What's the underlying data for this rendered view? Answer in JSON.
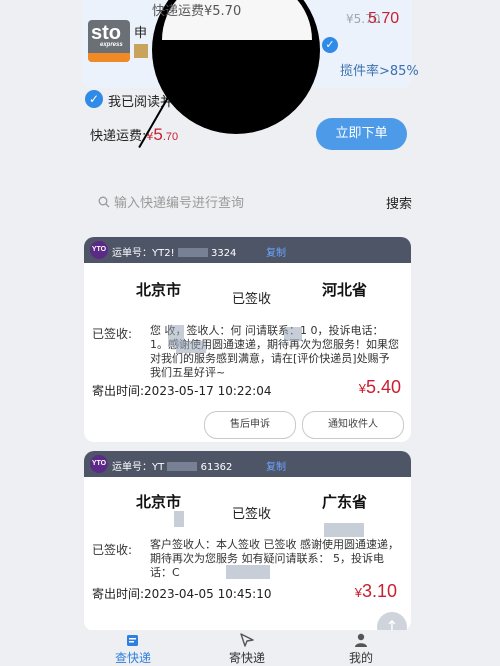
{
  "top_order": {
    "company_logo": "STO Express",
    "logo_main": "sto",
    "logo_sub": "express",
    "name_initial": "申",
    "faded_text": "¥5.70",
    "price": "5.70",
    "check_mark": "✓",
    "stir_rate": "揽件率>85%",
    "magnified_text": "快递运费¥5.70",
    "agree_text": "我已阅读并同",
    "fee_label": "快递运费:",
    "fee_yen": "¥",
    "fee_int": "5",
    "fee_dec": ".70",
    "order_button": "立即下单"
  },
  "search": {
    "placeholder": "输入快递编号进行查询",
    "button": "搜索"
  },
  "shipments": [
    {
      "logo": "YTO",
      "waybill_label": "运单号：YT2!",
      "waybill_tail": "3324",
      "copy": "复制",
      "from_city": "北京市",
      "status": "已签收",
      "to_city": "河北省",
      "detail_label": "已签收:",
      "detail_text": "您    收，签收人：何      问请联系：1        0，投诉电话：     1。感谢使用圆通速递，期待再次为您服务！如果您对我们的服务感到满意，请在[评价快递员]处赐予我们五星好评~",
      "time": "寄出时间:2023-05-17 10:22:04",
      "price_yen": "¥",
      "price": "5.40",
      "buttons": [
        "售后申诉",
        "通知收件人"
      ]
    },
    {
      "logo": "YTO",
      "waybill_label": "运单号：YT",
      "waybill_tail": "61362",
      "copy": "复制",
      "from_city": "北京市",
      "status": "已签收",
      "to_city": "广东省",
      "detail_label": "已签收:",
      "detail_text": "客户签收人：本人签收 已签收 感谢使用圆通速递，期待再次为您服务 如有疑问请联系：       5，投诉电话：C",
      "time": "寄出时间:2023-04-05 10:45:10",
      "price_yen": "¥",
      "price": "3.10"
    }
  ],
  "scroll_top": "↑",
  "nav": [
    {
      "label": "查快递",
      "icon": "search-package-icon",
      "active": true
    },
    {
      "label": "寄快递",
      "icon": "send-arrow-icon",
      "active": false
    },
    {
      "label": "我的",
      "icon": "user-icon",
      "active": false
    }
  ]
}
